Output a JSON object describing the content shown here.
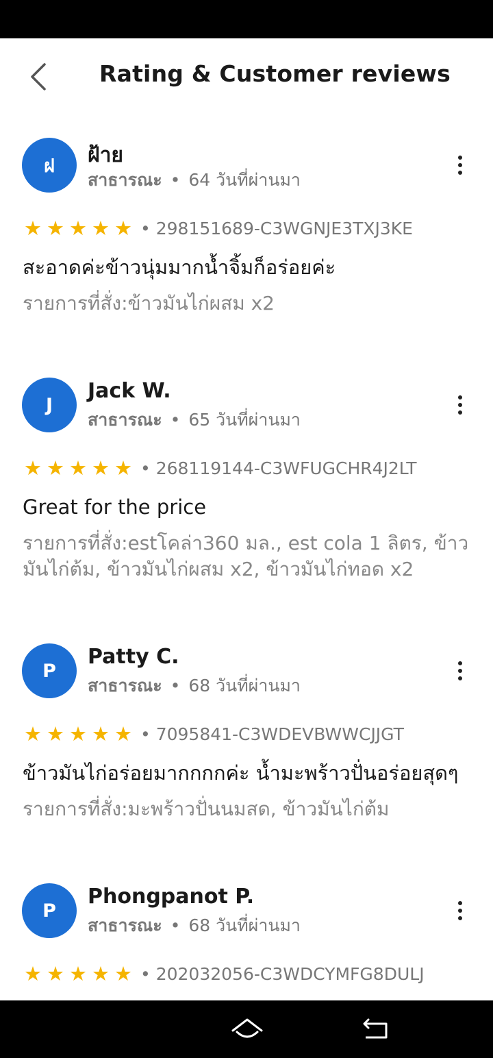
{
  "header": {
    "title": "Rating & Customer reviews"
  },
  "reviews": [
    {
      "avatar_letter": "ฝ",
      "name": "ฝ้าย",
      "visibility": "สาธารณะ",
      "separator": "•",
      "time_ago": "64 วันที่ผ่านมา",
      "rating": 5,
      "order_id": "• 298151689-C3WGNJE3TXJ3KE",
      "text": "สะอาดค่ะข้าวนุ่มมากน้ำจิ้มก็อร่อยค่ะ",
      "order_items": "รายการที่สั่ง:ข้าวมันไก่ผสม x2"
    },
    {
      "avatar_letter": "J",
      "name": "Jack W.",
      "visibility": "สาธารณะ",
      "separator": "•",
      "time_ago": "65 วันที่ผ่านมา",
      "rating": 5,
      "order_id": "• 268119144-C3WFUGCHR4J2LT",
      "text": "Great for the price",
      "order_items": "รายการที่สั่ง:estโคล่า360 มล., est cola 1 ลิตร, ข้าวมันไก่ต้ม, ข้าวมันไก่ผสม x2, ข้าวมันไก่ทอด x2"
    },
    {
      "avatar_letter": "P",
      "name": "Patty C.",
      "visibility": "สาธารณะ",
      "separator": "•",
      "time_ago": "68 วันที่ผ่านมา",
      "rating": 5,
      "order_id": "• 7095841-C3WDEVBWWCJJGT",
      "text": "ข้าวมันไก่อร่อยมากกกกค่ะ น้ำมะพร้าวปั่นอร่อยสุดๆ",
      "order_items": "รายการที่สั่ง:มะพร้าวปั่นนมสด, ข้าวมันไก่ต้ม"
    },
    {
      "avatar_letter": "P",
      "name": "Phongpanot P.",
      "visibility": "สาธารณะ",
      "separator": "•",
      "time_ago": "68 วันที่ผ่านมา",
      "rating": 5,
      "order_id": "• 202032056-C3WDCYMFG8DULJ"
    }
  ],
  "icons": {
    "back": "chevron-left-icon",
    "more": "more-vertical-icon",
    "star": "star-icon",
    "home": "home-icon",
    "nav_back": "back-arrow-icon"
  },
  "colors": {
    "avatar": "#1d6fd4",
    "star": "#f5b400",
    "muted_text": "#777777"
  }
}
